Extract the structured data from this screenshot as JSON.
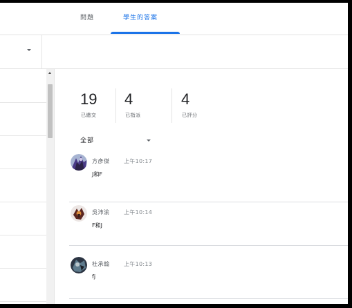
{
  "tabs": {
    "questions": "問題",
    "answers": "學生的答案",
    "active": "answers",
    "accent": "#1a73e8"
  },
  "toolbar": {
    "dropdown_icon": "caret-down-icon"
  },
  "stats": {
    "submitted": {
      "count": "19",
      "label": "已繳交"
    },
    "assigned": {
      "count": "4",
      "label": "已指派"
    },
    "graded": {
      "count": "4",
      "label": "已評分"
    }
  },
  "filter": {
    "label": "全部",
    "icon": "caret-down-icon"
  },
  "answers": [
    {
      "name": "方彥傑",
      "time": "上午10:17",
      "answer": "J和F"
    },
    {
      "name": "吳沛渝",
      "time": "上午10:14",
      "answer": "F和J"
    },
    {
      "name": "杜承翰",
      "time": "上午10:13",
      "answer": "fj"
    }
  ]
}
